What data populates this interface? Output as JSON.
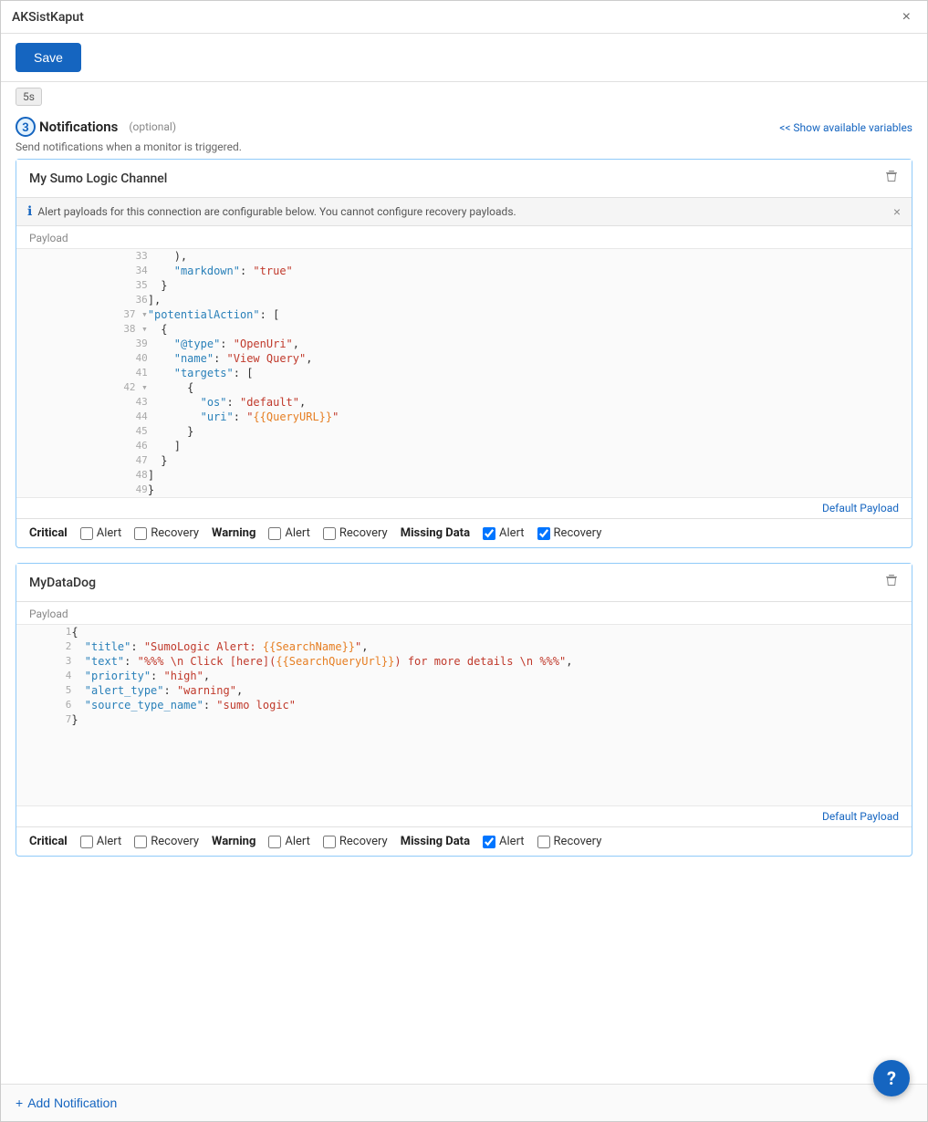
{
  "window": {
    "title": "AKSistKaput",
    "close_label": "×"
  },
  "toolbar": {
    "save_label": "Save"
  },
  "interval": {
    "value": "5s"
  },
  "section": {
    "step": "3",
    "title": "Notifications",
    "optional": "(optional)",
    "subtitle": "Send notifications when a monitor is triggered.",
    "show_variables": "<< Show available variables"
  },
  "card1": {
    "title": "My Sumo Logic Channel",
    "delete_icon": "🗑",
    "info_banner": "Alert payloads for this connection are configurable below. You cannot configure recovery payloads.",
    "payload_label": "Payload",
    "default_payload": "Default Payload",
    "code_lines": [
      {
        "num": "33",
        "content": "    ),"
      },
      {
        "num": "34",
        "content": "    \"markdown\":\"true\""
      },
      {
        "num": "35",
        "content": "  }"
      },
      {
        "num": "36",
        "content": "],"
      },
      {
        "num": "37",
        "content": "\"potentialAction\": [",
        "collapse": true
      },
      {
        "num": "38",
        "content": "  {",
        "collapse": true
      },
      {
        "num": "39",
        "content": "    \"@type\": \"OpenUri\","
      },
      {
        "num": "40",
        "content": "    \"name\": \"View Query\","
      },
      {
        "num": "41",
        "content": "    \"targets\": ["
      },
      {
        "num": "42",
        "content": "      {",
        "collapse": true
      },
      {
        "num": "43",
        "content": "        \"os\": \"default\","
      },
      {
        "num": "44",
        "content": "        \"uri\": \"{{QueryURL}}\""
      },
      {
        "num": "45",
        "content": "      }"
      },
      {
        "num": "46",
        "content": "    ]"
      },
      {
        "num": "47",
        "content": "  }"
      },
      {
        "num": "48",
        "content": "]"
      },
      {
        "num": "49",
        "content": "}"
      }
    ],
    "footer": {
      "critical_label": "Critical",
      "warning_label": "Warning",
      "missing_data_label": "Missing Data",
      "alert_label": "Alert",
      "recovery_label": "Recovery",
      "critical_alert_checked": false,
      "critical_recovery_checked": false,
      "warning_alert_checked": false,
      "warning_recovery_checked": false,
      "missing_alert_checked": true,
      "missing_recovery_checked": true
    }
  },
  "card2": {
    "title": "MyDataDog",
    "delete_icon": "🗑",
    "payload_label": "Payload",
    "default_payload": "Default Payload",
    "code_lines": [
      {
        "num": "1",
        "content": "{"
      },
      {
        "num": "2",
        "content": "  \"title\": \"SumoLogic Alert: {{SearchName}}\","
      },
      {
        "num": "3",
        "content": "  \"text\": \"%%% \\n Click [here]({{SearchQueryUrl}}) for more details \\n %%%\","
      },
      {
        "num": "4",
        "content": "  \"priority\":\"high\","
      },
      {
        "num": "5",
        "content": "  \"alert_type\":\"warning\","
      },
      {
        "num": "6",
        "content": "  \"source_type_name\":\"sumo logic\""
      },
      {
        "num": "7",
        "content": "}"
      }
    ],
    "footer": {
      "critical_label": "Critical",
      "warning_label": "Warning",
      "missing_data_label": "Missing Data",
      "alert_label": "Alert",
      "recovery_label": "Recovery",
      "critical_alert_checked": false,
      "critical_recovery_checked": false,
      "warning_alert_checked": false,
      "warning_recovery_checked": false,
      "missing_alert_checked": true,
      "missing_recovery_checked": false
    }
  },
  "add_notification": {
    "label": "Add Notification",
    "plus": "+"
  },
  "help": {
    "label": "?"
  }
}
